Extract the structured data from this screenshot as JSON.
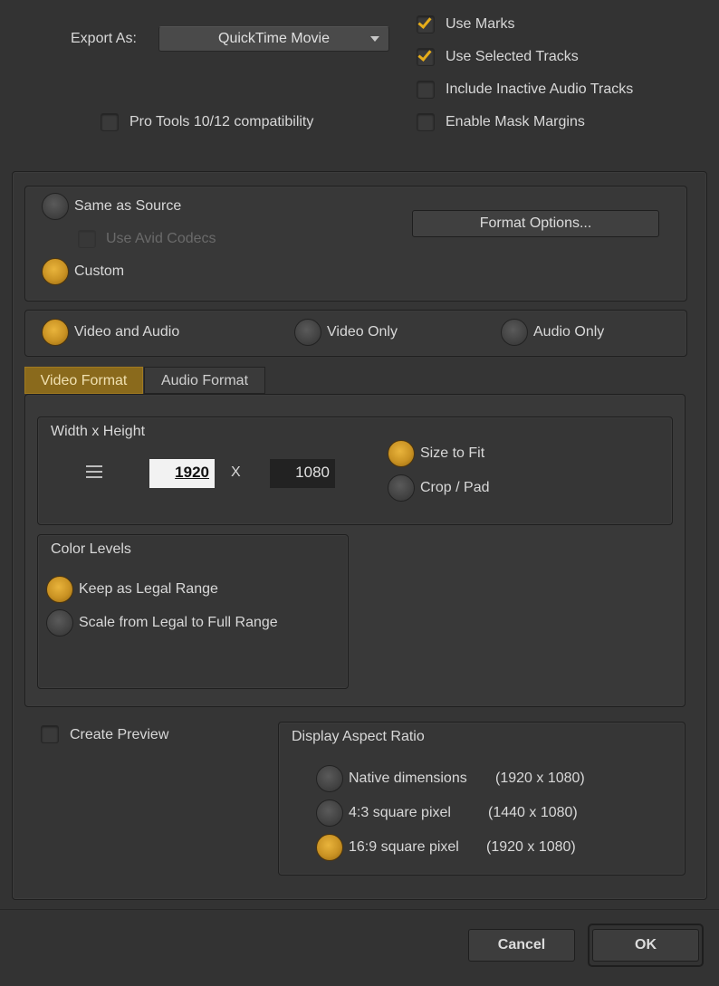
{
  "export": {
    "label": "Export As:",
    "value": "QuickTime Movie"
  },
  "options": {
    "use_marks": {
      "label": "Use Marks",
      "checked": true
    },
    "use_selected_tracks": {
      "label": "Use Selected Tracks",
      "checked": true
    },
    "include_inactive_audio": {
      "label": "Include Inactive Audio Tracks",
      "checked": false
    },
    "enable_mask_margins": {
      "label": "Enable Mask Margins",
      "checked": false
    },
    "pro_tools": {
      "label": "Pro Tools 10/12 compatibility",
      "checked": false
    }
  },
  "source": {
    "same_as_source": "Same as Source",
    "use_avid_codecs": "Use Avid Codecs",
    "custom": "Custom",
    "format_options_button": "Format Options...",
    "selected": "Custom"
  },
  "tracks": {
    "video_and_audio": "Video and Audio",
    "video_only": "Video Only",
    "audio_only": "Audio Only",
    "selected": "Video and Audio"
  },
  "tabs": [
    {
      "label": "Video Format",
      "active": true
    },
    {
      "label": "Audio Format",
      "active": false
    }
  ],
  "video_format": {
    "size_title": "Width x Height",
    "width": "1920",
    "times": "X",
    "height": "1080",
    "size_to_fit": "Size to Fit",
    "crop_pad": "Crop / Pad",
    "size_mode_selected": "Size to Fit",
    "color_levels_title": "Color Levels",
    "keep_legal": "Keep as Legal Range",
    "scale_full": "Scale from Legal to Full Range",
    "color_selected": "Keep as Legal Range"
  },
  "preview": {
    "label": "Create Preview",
    "checked": false
  },
  "aspect": {
    "title": "Display Aspect Ratio",
    "native": "Native dimensions",
    "native_dims": "(1920 x 1080)",
    "four_three": "4:3 square pixel",
    "four_three_dims": "(1440 x 1080)",
    "sixteen_nine": "16:9 square pixel",
    "sixteen_nine_dims": "(1920 x 1080)",
    "selected": "16:9 square pixel"
  },
  "footer": {
    "cancel": "Cancel",
    "ok": "OK"
  },
  "colors": {
    "background": "#333333",
    "accent": "#d4a02a",
    "checkmark": "#e6ad1a"
  }
}
